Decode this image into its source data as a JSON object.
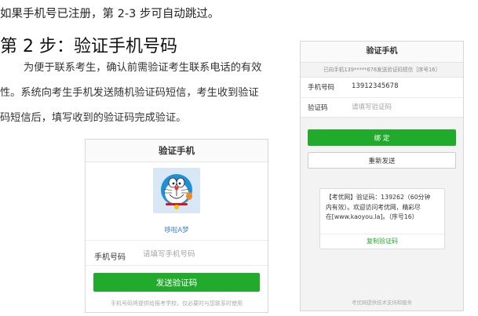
{
  "intro_line": "如果手机号已注册，第 2-3 步可自动跳过。",
  "step_title": "第 2 步：验证手机号码",
  "paragraph_lines": [
    "为便于联系考生，确认前需验证考生联系电话的有效",
    "性。系统向考生手机发送随机验证码短信，考生收到验证",
    "码短信后，填写收到的验证码完成验证。"
  ],
  "left_phone": {
    "title": "验证手机",
    "avatar_name": "哆啦A梦",
    "phone_label": "手机号码",
    "phone_placeholder": "请填写手机号码",
    "send_button": "发送验证码",
    "notice": "手机号码将提供给报考学校，仅必要时与您联系时使用"
  },
  "right_phone": {
    "title": "验证手机",
    "sent_info": "已向手机139*****678发送验证码短信［序号16］",
    "phone_label": "手机号码",
    "phone_value": "13912345678",
    "code_label": "验证码",
    "code_placeholder": "请填写验证码",
    "bind_button": "绑 定",
    "resend_button": "重新发送",
    "sms_lines": [
      "【考优网】验证码：139262（60分钟",
      "内有效）。欢迎访问考优网，精彩尽",
      "在[www.kaoyou.la]。（序号16）"
    ],
    "copy_button": "复制验证码",
    "footer": "考优网提供技术支持和服务"
  },
  "colors": {
    "primary_green": "#22aa2c",
    "link_blue": "#3a84c4"
  }
}
